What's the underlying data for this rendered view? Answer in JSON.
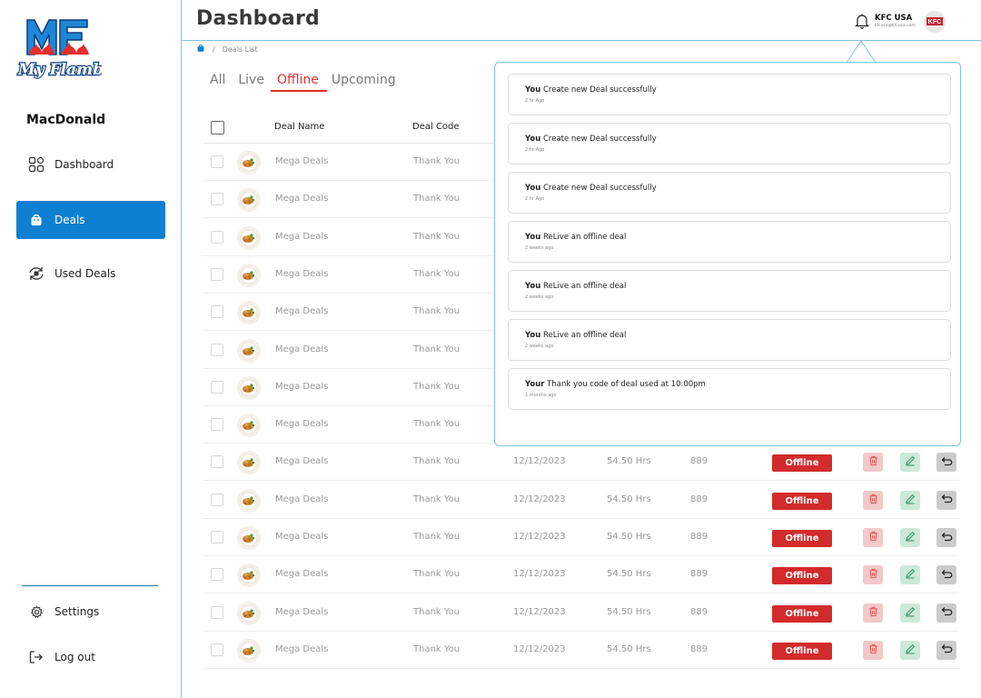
{
  "sidebar": {
    "logo_text": "MF",
    "logo_script": "My Flambé",
    "brand": "MacDonald",
    "nav": [
      {
        "label": "Dashboard",
        "icon": "grid-icon"
      },
      {
        "label": "Deals",
        "icon": "bag-icon",
        "active": true
      },
      {
        "label": "Used Deals",
        "icon": "recycle-icon"
      }
    ],
    "bottom": [
      {
        "label": "Settings",
        "icon": "gear-icon"
      },
      {
        "label": "Log out",
        "icon": "logout-icon"
      }
    ]
  },
  "header": {
    "title": "Dashboard",
    "breadcrumb": {
      "separator": "/",
      "current": "Deals List"
    },
    "user": {
      "name": "KFC USA",
      "email": "kfcusa@kfcusa.com"
    },
    "avatar_text": "KFC"
  },
  "tabs": [
    {
      "label": "All"
    },
    {
      "label": "Live"
    },
    {
      "label": "Offline",
      "active": true
    },
    {
      "label": "Upcoming"
    }
  ],
  "table": {
    "columns": {
      "name": "Deal Name",
      "code": "Deal Code"
    },
    "rows": [
      {
        "name": "Mega Deals",
        "code": "Thank You"
      },
      {
        "name": "Mega Deals",
        "code": "Thank You"
      },
      {
        "name": "Mega Deals",
        "code": "Thank You"
      },
      {
        "name": "Mega Deals",
        "code": "Thank You"
      },
      {
        "name": "Mega Deals",
        "code": "Thank You"
      },
      {
        "name": "Mega Deals",
        "code": "Thank You"
      },
      {
        "name": "Mega Deals",
        "code": "Thank You"
      },
      {
        "name": "Mega Deals",
        "code": "Thank You"
      },
      {
        "name": "Mega Deals",
        "code": "Thank You",
        "date": "12/12/2023",
        "duration": "54.50 Hrs",
        "count": "889",
        "status": "Offline"
      },
      {
        "name": "Mega Deals",
        "code": "Thank You",
        "date": "12/12/2023",
        "duration": "54.50 Hrs",
        "count": "889",
        "status": "Offline"
      },
      {
        "name": "Mega Deals",
        "code": "Thank You",
        "date": "12/12/2023",
        "duration": "54.50 Hrs",
        "count": "889",
        "status": "Offline"
      },
      {
        "name": "Mega Deals",
        "code": "Thank You",
        "date": "12/12/2023",
        "duration": "54.50 Hrs",
        "count": "889",
        "status": "Offline"
      },
      {
        "name": "Mega Deals",
        "code": "Thank You",
        "date": "12/12/2023",
        "duration": "54.50 Hrs",
        "count": "889",
        "status": "Offline"
      },
      {
        "name": "Mega Deals",
        "code": "Thank You",
        "date": "12/12/2023",
        "duration": "54.50 Hrs",
        "count": "889",
        "status": "Offline"
      }
    ]
  },
  "notifications": [
    {
      "actor": "You",
      "message": "Create new Deal successfully",
      "time": "2 hr Ago"
    },
    {
      "actor": "You",
      "message": "Create new Deal successfully",
      "time": "2 hr Ago"
    },
    {
      "actor": "You",
      "message": "Create new Deal successfully",
      "time": "2 hr Ago"
    },
    {
      "actor": "You",
      "message": "ReLive an offline deal",
      "time": "2 weeks ago"
    },
    {
      "actor": "You",
      "message": "ReLive an offline deal",
      "time": "2 weeks ago"
    },
    {
      "actor": "You",
      "message": "ReLive an offline deal",
      "time": "2 weeks ago"
    },
    {
      "actor": "Your",
      "message": "Thank you code of deal used at 10:00pm",
      "time": "1 months ago"
    }
  ],
  "colors": {
    "primary": "#0f7fd2",
    "accent_red": "#d32b2b",
    "tab_active": "#e03131",
    "border_blue": "#7fc3e3"
  }
}
